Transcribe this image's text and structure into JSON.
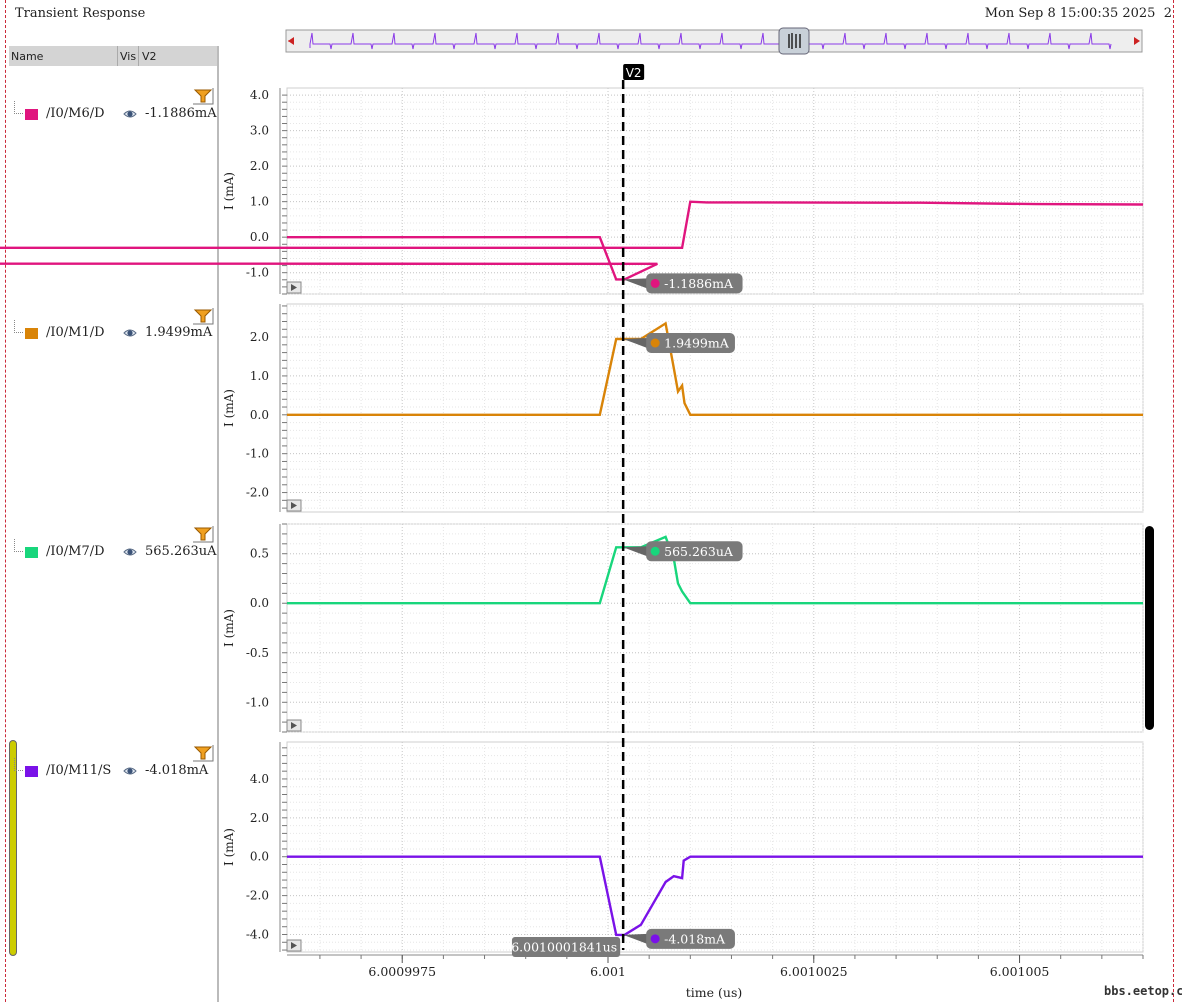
{
  "window": {
    "title": "Transient Response",
    "datetime": "Mon Sep 8 15:00:35 2025",
    "datetime_suffix": "2"
  },
  "sidebar": {
    "columns": {
      "name": "Name",
      "vis": "Vis",
      "cursor": "V2"
    },
    "traces": [
      {
        "name": "/I0/M6/D",
        "value": "-1.1886mA",
        "color": "#e0157e",
        "visible_icon": "eye-icon"
      },
      {
        "name": "/I0/M1/D",
        "value": "1.9499mA",
        "color": "#d98408",
        "visible_icon": "eye-icon"
      },
      {
        "name": "/I0/M7/D",
        "value": "565.263uA",
        "color": "#18d67c",
        "visible_icon": "eye-icon"
      },
      {
        "name": "/I0/M11/S",
        "value": "-4.018mA",
        "color": "#7a12e8",
        "visible_icon": "eye-icon"
      }
    ],
    "filter_icon": "filter-icon"
  },
  "watermark": "bbs.eetop.cn",
  "chart_data": {
    "type": "line",
    "xlabel": "time (us)",
    "xlim": [
      6.0009961,
      6.0010065
    ],
    "x_ticks": [
      {
        "value": 6.0009975,
        "label": "6.0009975"
      },
      {
        "value": 6.001,
        "label": "6.001"
      },
      {
        "value": 6.0010025,
        "label": "6.0010025"
      },
      {
        "value": 6.001005,
        "label": "6.001005"
      }
    ],
    "grid": true,
    "cursor": {
      "name": "V2",
      "x": 6.0010001841,
      "label": "6.0010001841us"
    },
    "subplots": [
      {
        "series_name": "/I0/M6/D",
        "ylabel": "I (mA)",
        "ylim": [
          -1.6,
          4.2
        ],
        "y_ticks": [
          {
            "value": 4.0,
            "label": "4.0"
          },
          {
            "value": 3.0,
            "label": "3.0"
          },
          {
            "value": 2.0,
            "label": "2.0"
          },
          {
            "value": 1.0,
            "label": "1.0"
          },
          {
            "value": 0.0,
            "label": "0.0"
          },
          {
            "value": -1.0,
            "label": "-1.0"
          }
        ],
        "color": "#e0157e",
        "x": [
          6.0009961,
          6.0009999,
          6.0010001,
          6.0010002,
          6.0010006,
          6.000001,
          6.0010009,
          6.001001,
          6.0010012,
          6.0010038,
          6.0010052,
          6.0010065
        ],
        "y": [
          0.0,
          0.0,
          -1.1886,
          -1.19,
          -0.75,
          -0.3,
          -0.3,
          1.0,
          0.98,
          0.97,
          0.93,
          0.92
        ],
        "marker": {
          "label": "-1.1886mA",
          "x": 6.0010001841,
          "y": -1.1886
        }
      },
      {
        "series_name": "/I0/M1/D",
        "ylabel": "I (mA)",
        "ylim": [
          -2.5,
          2.85
        ],
        "y_ticks": [
          {
            "value": 2.0,
            "label": "2.0"
          },
          {
            "value": 1.0,
            "label": "1.0"
          },
          {
            "value": 0.0,
            "label": "0.0"
          },
          {
            "value": -1.0,
            "label": "-1.0"
          },
          {
            "value": -2.0,
            "label": "-2.0"
          }
        ],
        "color": "#d98408",
        "x": [
          6.0009961,
          6.0009999,
          6.0010001,
          6.0010004,
          6.0010007,
          6.0010008,
          6.00100085,
          6.0010009,
          6.00100093,
          6.001001,
          6.0010065
        ],
        "y": [
          0.0,
          0.0,
          1.95,
          1.95,
          2.35,
          1.2,
          0.6,
          0.75,
          0.3,
          0.0,
          0.0
        ],
        "marker": {
          "label": "1.9499mA",
          "x": 6.0010001841,
          "y": 1.9499
        }
      },
      {
        "series_name": "/I0/M7/D",
        "ylabel": "I (mA)",
        "ylim": [
          -1.3,
          0.8
        ],
        "y_ticks": [
          {
            "value": 0.5,
            "label": "0.5"
          },
          {
            "value": 0.0,
            "label": "0.0"
          },
          {
            "value": -0.5,
            "label": "-0.5"
          },
          {
            "value": -1.0,
            "label": "-1.0"
          }
        ],
        "color": "#18d67c",
        "x": [
          6.0009961,
          6.0009999,
          6.0010001,
          6.0010004,
          6.0010007,
          6.0010008,
          6.00100085,
          6.0010009,
          6.001001,
          6.0010065
        ],
        "y": [
          0.0,
          0.0,
          0.565,
          0.565,
          0.67,
          0.45,
          0.2,
          0.12,
          0.0,
          0.0
        ],
        "marker": {
          "label": "565.263uA",
          "x": 6.0010001841,
          "y": 0.565263
        }
      },
      {
        "series_name": "/I0/M11/S",
        "ylabel": "I (mA)",
        "ylim": [
          -4.9,
          5.9
        ],
        "y_ticks": [
          {
            "value": 4.0,
            "label": "4.0"
          },
          {
            "value": 2.0,
            "label": "2.0"
          },
          {
            "value": 0.0,
            "label": "0.0"
          },
          {
            "value": -2.0,
            "label": "-2.0"
          },
          {
            "value": -4.0,
            "label": "-4.0"
          }
        ],
        "color": "#7a12e8",
        "x": [
          6.0009961,
          6.0009999,
          6.0010001,
          6.0010002,
          6.0010004,
          6.0010007,
          6.0010008,
          6.0010009,
          6.00100092,
          6.001001,
          6.0010065
        ],
        "y": [
          0.0,
          0.0,
          -4.018,
          -4.02,
          -3.5,
          -1.3,
          -1.0,
          -1.1,
          -0.2,
          0.0,
          0.0
        ],
        "marker": {
          "label": "-4.018mA",
          "x": 6.0010001841,
          "y": -4.018
        }
      }
    ]
  }
}
